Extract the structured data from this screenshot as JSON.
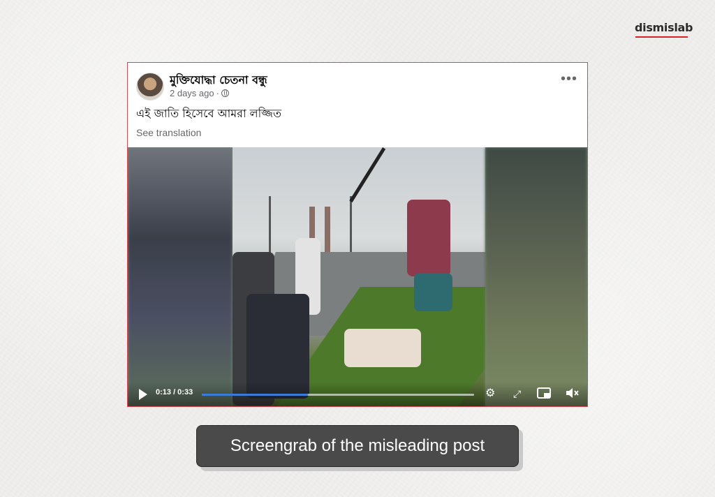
{
  "brand": {
    "name": "dismislab",
    "accent_color": "#d8232a"
  },
  "post": {
    "author": "মুক্তিযোদ্ধা চেতনা বন্ধু",
    "timestamp": "2 days ago",
    "separator": "·",
    "privacy_icon": "globe-icon",
    "more_label": "•••",
    "text": "এই জাতি হিসেবে আমরা লজ্জিত",
    "see_translation": "See translation"
  },
  "video": {
    "time_display": "0:13 / 0:33",
    "progress": 0.39,
    "progress_color": "#3b7bd8",
    "controls": [
      "play-icon",
      "settings-icon",
      "fullscreen-icon",
      "picture-in-picture-icon",
      "mute-icon"
    ]
  },
  "caption": {
    "text": "Screengrab of the misleading post"
  }
}
